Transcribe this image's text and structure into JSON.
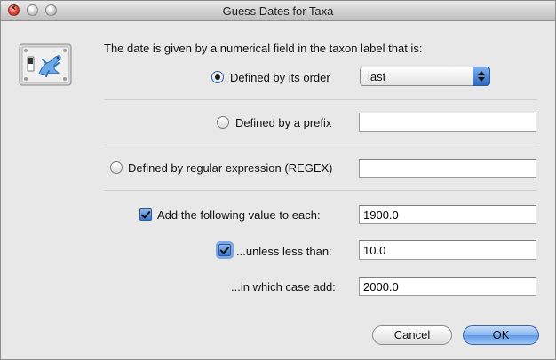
{
  "window": {
    "title": "Guess Dates for Taxa"
  },
  "dialog": {
    "intro": "The date is given by a numerical field in the taxon label that is:",
    "options": {
      "order": {
        "label": "Defined by its order",
        "selected": true,
        "select_value": "last"
      },
      "prefix": {
        "label": "Defined by a prefix",
        "selected": false,
        "value": ""
      },
      "regex": {
        "label": "Defined by regular expression (REGEX)",
        "selected": false,
        "value": ""
      }
    },
    "add_value": {
      "label": "Add the following value to each:",
      "checked": true,
      "value": "1900.0"
    },
    "unless": {
      "label": "...unless less than:",
      "checked": true,
      "value": "10.0"
    },
    "case_add": {
      "label": "...in which case add:",
      "value": "2000.0"
    },
    "buttons": {
      "cancel": "Cancel",
      "ok": "OK"
    }
  },
  "colors": {
    "accent": "#3a78d2",
    "window_bg": "#e8e8e8"
  },
  "icons": {
    "app": "beast-gecko-icon",
    "close": "close-icon",
    "minimize": "minimize-icon",
    "zoom": "zoom-icon"
  }
}
